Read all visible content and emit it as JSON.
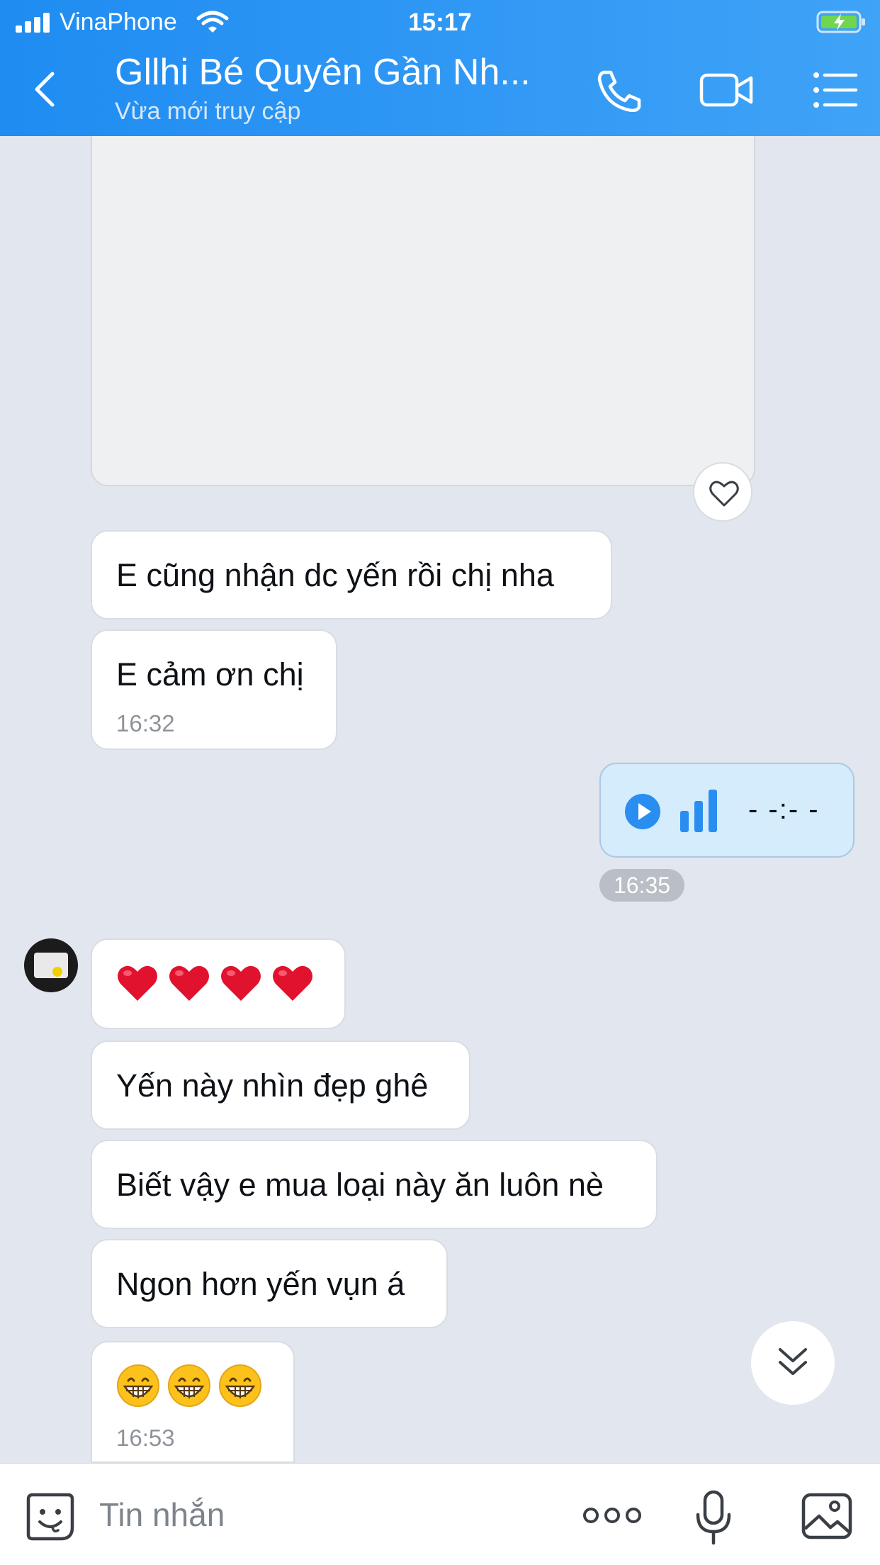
{
  "status_bar": {
    "carrier": "VinaPhone",
    "time": "15:17"
  },
  "header": {
    "title": "Gllhi Bé Quyên Gần Nh...",
    "subtitle": "Vừa mới truy cập"
  },
  "messages": [
    {
      "text": "E cũng nhận dc yến rồi chị nha"
    },
    {
      "text": "E cảm ơn chị",
      "time": "16:32"
    },
    {
      "voice_duration": "- -:- -",
      "time": "16:35"
    },
    {
      "emoji": "❤️❤️❤️❤️"
    },
    {
      "text": "Yến này nhìn đẹp ghê"
    },
    {
      "text": "Biết vậy e mua loại này ăn luôn nè"
    },
    {
      "text": "Ngon hơn yến vụn á"
    },
    {
      "emoji": "😁😁😁",
      "time": "16:53"
    }
  ],
  "input": {
    "placeholder": "Tin nhắn"
  },
  "colors": {
    "header_start": "#1f8cf2",
    "header_end": "#3fa3f7",
    "chat_background": "#e2e6ee",
    "outgoing_bubble": "#d5ecfd",
    "accent": "#2a8df0",
    "heart_red": "#e1122e"
  },
  "icons": [
    "signal-icon",
    "wifi-icon",
    "battery-charging-icon",
    "back-icon",
    "phone-icon",
    "video-icon",
    "menu-icon",
    "heart-outline-icon",
    "play-icon",
    "audio-bars-icon",
    "chevron-double-down-icon",
    "sticker-icon",
    "more-icon",
    "microphone-icon",
    "image-icon"
  ]
}
